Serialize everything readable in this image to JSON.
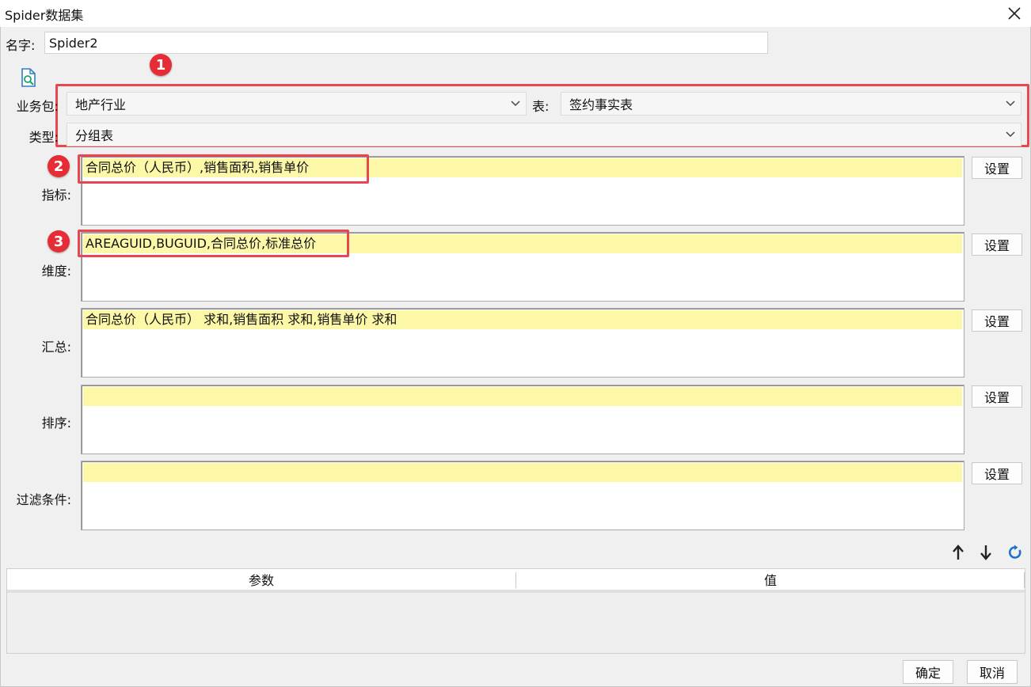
{
  "window": {
    "title": "Spider数据集"
  },
  "name_field": {
    "label": "名字:",
    "value": "Spider2"
  },
  "selectors": {
    "package_label": "业务包:",
    "package_value": "地产行业",
    "table_label": "表:",
    "table_value": "签约事实表",
    "type_label": "类型:",
    "type_value": "分组表"
  },
  "sections": {
    "metrics": {
      "label": "指标:",
      "value": "合同总价（人民币）,销售面积,销售单价",
      "button": "设置"
    },
    "dimensions": {
      "label": "维度:",
      "value": "AREAGUID,BUGUID,合同总价,标准总价",
      "button": "设置"
    },
    "summary": {
      "label": "汇总:",
      "value": "合同总价（人民币） 求和,销售面积 求和,销售单价 求和",
      "button": "设置"
    },
    "sort": {
      "label": "排序:",
      "value": "",
      "button": "设置"
    },
    "filter": {
      "label": "过滤条件:",
      "value": "",
      "button": "设置"
    }
  },
  "badges": [
    "1",
    "2",
    "3"
  ],
  "params_table": {
    "columns": [
      "参数",
      "值"
    ]
  },
  "footer": {
    "ok": "确定",
    "cancel": "取消"
  },
  "colors": {
    "highlight": "#fdf8a8",
    "annotation_red": "#e8474f",
    "refresh_blue": "#1e73c8"
  },
  "icons": {
    "preview": "preview-document-icon",
    "close": "close-icon",
    "move_up": "arrow-up-icon",
    "move_down": "arrow-down-icon",
    "refresh": "refresh-icon"
  }
}
